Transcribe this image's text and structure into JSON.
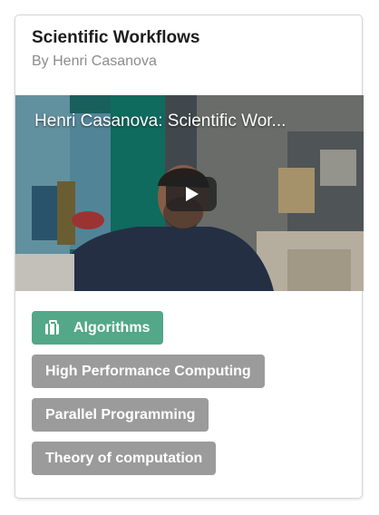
{
  "card": {
    "title": "Scientific Workflows",
    "author": "By Henri Casanova"
  },
  "video": {
    "title": "Henri Casanova: Scientific Wor...",
    "play_icon": "play-icon"
  },
  "tags": [
    {
      "label": "Algorithms",
      "icon": "briefcase-icon",
      "color": "#52a888"
    },
    {
      "label": "High Performance Computing",
      "color": "#9b9b9b"
    },
    {
      "label": "Parallel Programming",
      "color": "#9b9b9b"
    },
    {
      "label": "Theory of computation",
      "color": "#9b9b9b"
    }
  ]
}
